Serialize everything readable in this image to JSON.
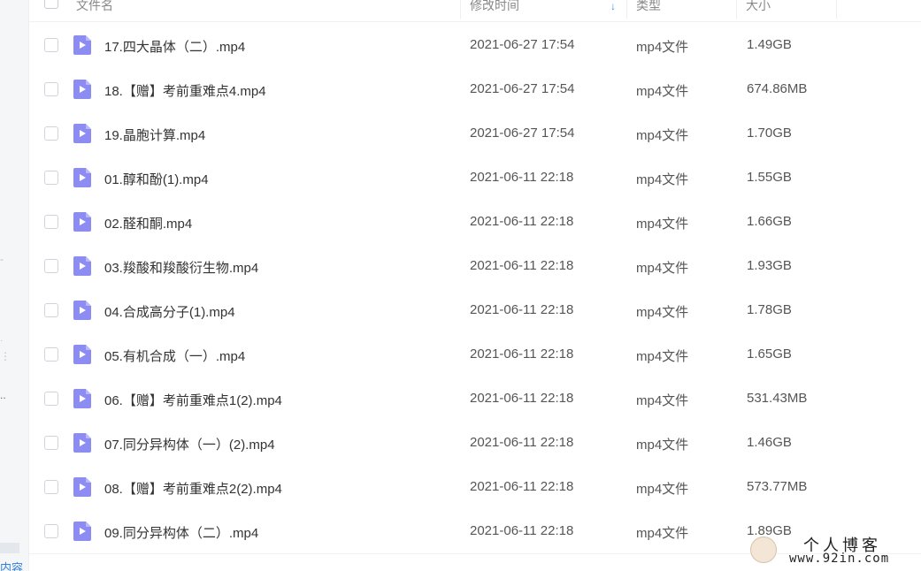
{
  "header": {
    "name_label": "文件名",
    "time_label": "修改时间",
    "type_label": "类型",
    "size_label": "大小",
    "sort_icon": "↓"
  },
  "files": [
    {
      "name": "17.四大晶体（二）.mp4",
      "time": "2021-06-27 17:54",
      "type": "mp4文件",
      "size": "1.49GB"
    },
    {
      "name": "18.【赠】考前重难点4.mp4",
      "time": "2021-06-27 17:54",
      "type": "mp4文件",
      "size": "674.86MB"
    },
    {
      "name": "19.晶胞计算.mp4",
      "time": "2021-06-27 17:54",
      "type": "mp4文件",
      "size": "1.70GB"
    },
    {
      "name": "01.醇和酚(1).mp4",
      "time": "2021-06-11 22:18",
      "type": "mp4文件",
      "size": "1.55GB"
    },
    {
      "name": "02.醛和酮.mp4",
      "time": "2021-06-11 22:18",
      "type": "mp4文件",
      "size": "1.66GB"
    },
    {
      "name": "03.羧酸和羧酸衍生物.mp4",
      "time": "2021-06-11 22:18",
      "type": "mp4文件",
      "size": "1.93GB"
    },
    {
      "name": "04.合成高分子(1).mp4",
      "time": "2021-06-11 22:18",
      "type": "mp4文件",
      "size": "1.78GB"
    },
    {
      "name": "05.有机合成（一）.mp4",
      "time": "2021-06-11 22:18",
      "type": "mp4文件",
      "size": "1.65GB"
    },
    {
      "name": "06.【赠】考前重难点1(2).mp4",
      "time": "2021-06-11 22:18",
      "type": "mp4文件",
      "size": "531.43MB"
    },
    {
      "name": "07.同分异构体（一）(2).mp4",
      "time": "2021-06-11 22:18",
      "type": "mp4文件",
      "size": "1.46GB"
    },
    {
      "name": "08.【赠】考前重难点2(2).mp4",
      "time": "2021-06-11 22:18",
      "type": "mp4文件",
      "size": "573.77MB"
    },
    {
      "name": "09.同分异构体（二）.mp4",
      "time": "2021-06-11 22:18",
      "type": "mp4文件",
      "size": "1.89GB"
    }
  ],
  "sidebar": {
    "dots": "⋮",
    "ellipsis": "..",
    "link_text": "内容"
  },
  "watermark": {
    "title": "个人博客",
    "url": "www.92in.com"
  },
  "colors": {
    "file_icon": "#8c8cf2",
    "accent": "#3b8ef0"
  }
}
